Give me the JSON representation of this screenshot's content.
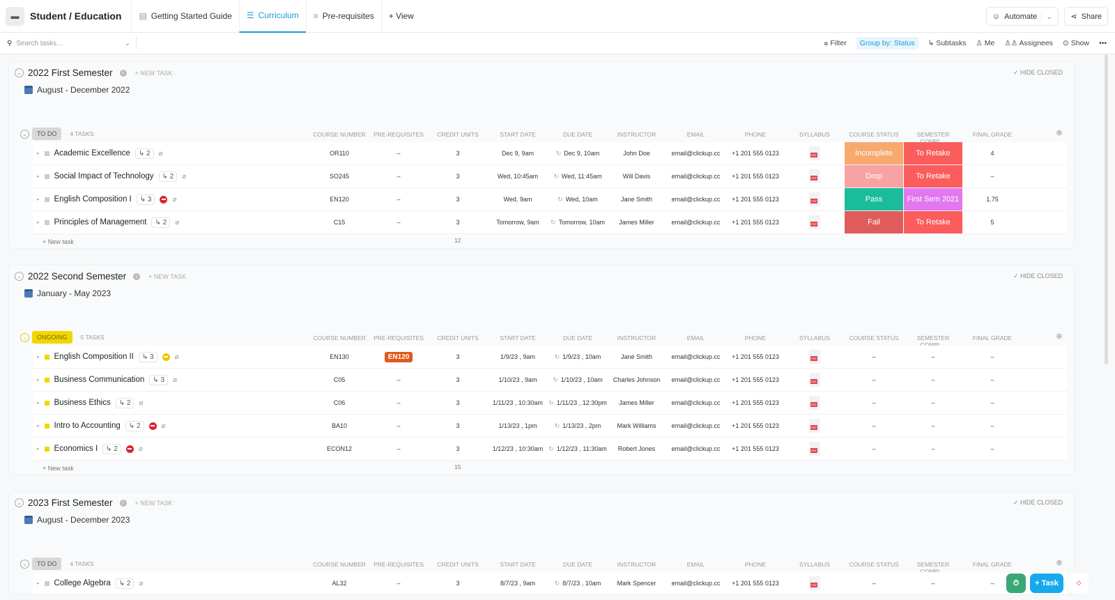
{
  "header": {
    "workspace": "Student / Education",
    "tabs": [
      {
        "label": "Getting Started Guide",
        "icon": "doc-icon"
      },
      {
        "label": "Curriculum",
        "icon": "list-icon",
        "active": true
      },
      {
        "label": "Pre-requisites",
        "icon": "list-icon"
      }
    ],
    "add_view": "+ View",
    "automate": "Automate",
    "share": "Share"
  },
  "toolbar": {
    "search_placeholder": "Search tasks...",
    "filter": "Filter",
    "group_by": "Group by: Status",
    "subtasks": "Subtasks",
    "me": "Me",
    "assignees": "Assignees",
    "show": "Show",
    "more": "•••"
  },
  "columns": [
    "COURSE NUMBER",
    "PRE-REQUISITES",
    "CREDIT UNITS",
    "START DATE",
    "DUE DATE",
    "INSTRUCTOR",
    "EMAIL",
    "PHONE",
    "SYLLABUS",
    "COURSE STATUS",
    "SEMESTER COMPL...",
    "FINAL GRADE"
  ],
  "labels": {
    "new_task_header": "+ NEW TASK",
    "hide_closed": "✓ HIDE CLOSED",
    "new_task": "+ New task"
  },
  "colors": {
    "incomplete": "#f8a96e",
    "drop": "#f7a3a3",
    "pass": "#1bbc9b",
    "fail": "#e05c5c",
    "retake": "#fb5c5c",
    "firstsem": "#e277f0",
    "todo": "#d8d8d8",
    "ongoing": "#f2d600",
    "accent": "#1a9ad6"
  },
  "sections": [
    {
      "title": "2022 First Semester",
      "dates": "August - December 2022",
      "group": "TO DO",
      "count": "4 TASKS",
      "sum": "12",
      "tasks": [
        {
          "name": "Academic Excellence",
          "sub": "2",
          "block": "",
          "course": "OR110",
          "pre": "–",
          "credit": "3",
          "start": "Dec 9, 9am",
          "due": "Dec 9, 10am",
          "instructor": "John Doe",
          "email": "email@clickup.cc",
          "phone": "+1 201 555 0123",
          "status": "Incomplete",
          "status_color": "#f8a96e",
          "sem": "To Retake",
          "sem_color": "#fb5c5c",
          "grade": "4"
        },
        {
          "name": "Social Impact of Technology",
          "sub": "2",
          "block": "",
          "course": "SO245",
          "pre": "–",
          "credit": "3",
          "start": "Wed, 10:45am",
          "due": "Wed, 11:45am",
          "instructor": "Will Davis",
          "email": "email@clickup.cc",
          "phone": "+1 201 555 0123",
          "status": "Drop",
          "status_color": "#f7a3a3",
          "sem": "To Retake",
          "sem_color": "#fb5c5c",
          "grade": "–"
        },
        {
          "name": "English Composition I",
          "sub": "3",
          "block": "red",
          "course": "EN120",
          "pre": "–",
          "credit": "3",
          "start": "Wed, 9am",
          "due": "Wed, 10am",
          "instructor": "Jane Smith",
          "email": "email@clickup.cc",
          "phone": "+1 201 555 0123",
          "status": "Pass",
          "status_color": "#1bbc9b",
          "sem": "First Sem 2021",
          "sem_color": "#e277f0",
          "grade": "1.75"
        },
        {
          "name": "Principles of Management",
          "sub": "2",
          "block": "",
          "course": "C15",
          "pre": "–",
          "credit": "3",
          "start": "Tomorrow, 9am",
          "due": "Tomorrow, 10am",
          "instructor": "James Miller",
          "email": "email@clickup.cc",
          "phone": "+1 201 555 0123",
          "status": "Fail",
          "status_color": "#e05c5c",
          "sem": "To Retake",
          "sem_color": "#fb5c5c",
          "grade": "5"
        }
      ]
    },
    {
      "title": "2022 Second Semester",
      "dates": "January - May 2023",
      "group": "ONGOING",
      "count": "5 TASKS",
      "sum": "15",
      "tasks": [
        {
          "name": "English Composition II",
          "sub": "3",
          "block": "yellow",
          "course": "EN130",
          "pre": "EN120",
          "credit": "3",
          "start": "1/9/23 , 9am",
          "due": "1/9/23 , 10am",
          "instructor": "Jane Smith",
          "email": "email@clickup.cc",
          "phone": "+1 201 555 0123",
          "status": "–",
          "sem": "–",
          "grade": "–"
        },
        {
          "name": "Business Communication",
          "sub": "3",
          "block": "",
          "course": "C05",
          "pre": "–",
          "credit": "3",
          "start": "1/10/23 , 9am",
          "due": "1/10/23 , 10am",
          "instructor": "Charles Johnson",
          "email": "email@clickup.cc",
          "phone": "+1 201 555 0123",
          "status": "–",
          "sem": "–",
          "grade": "–"
        },
        {
          "name": "Business Ethics",
          "sub": "2",
          "block": "",
          "course": "C06",
          "pre": "–",
          "credit": "3",
          "start": "1/11/23 , 10:30am",
          "due": "1/11/23 , 12:30pm",
          "instructor": "James Miller",
          "email": "email@clickup.cc",
          "phone": "+1 201 555 0123",
          "status": "–",
          "sem": "–",
          "grade": "–"
        },
        {
          "name": "Intro to Accounting",
          "sub": "2",
          "block": "red",
          "course": "BA10",
          "pre": "–",
          "credit": "3",
          "start": "1/13/23 , 1pm",
          "due": "1/13/23 , 2pm",
          "instructor": "Mark Williams",
          "email": "email@clickup.cc",
          "phone": "+1 201 555 0123",
          "status": "–",
          "sem": "–",
          "grade": "–"
        },
        {
          "name": "Economics I",
          "sub": "2",
          "block": "red",
          "course": "ECON12",
          "pre": "–",
          "credit": "3",
          "start": "1/12/23 , 10:30am",
          "due": "1/12/23 , 11:30am",
          "instructor": "Robert Jones",
          "email": "email@clickup.cc",
          "phone": "+1 201 555 0123",
          "status": "–",
          "sem": "–",
          "grade": "–"
        }
      ]
    },
    {
      "title": "2023 First Semester",
      "dates": "August - December 2023",
      "group": "TO DO",
      "count": "4 TASKS",
      "tasks": [
        {
          "name": "College Algebra",
          "sub": "2",
          "block": "",
          "course": "AL32",
          "pre": "–",
          "credit": "3",
          "start": "8/7/23 , 9am",
          "due": "8/7/23 , 10am",
          "instructor": "Mark Spencer",
          "email": "email@clickup.cc",
          "phone": "+1 201 555 0123",
          "status": "–",
          "sem": "–",
          "grade": "–"
        }
      ]
    }
  ],
  "fab": {
    "task": "+ Task"
  }
}
